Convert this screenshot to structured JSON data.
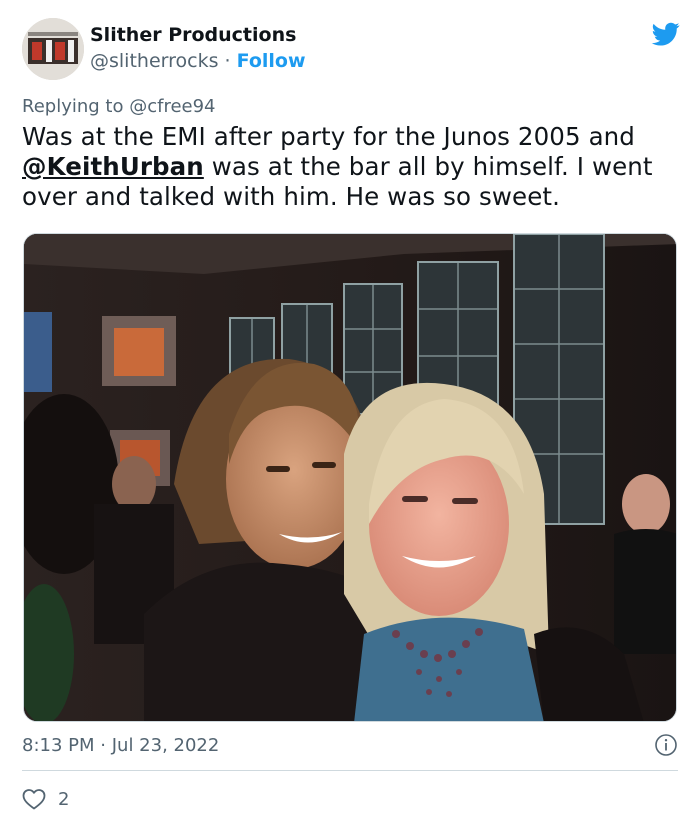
{
  "tweet": {
    "author_name": "Slither Productions",
    "author_handle": "@slitherrocks",
    "separator": "·",
    "follow_label": "Follow",
    "replying_prefix": "Replying to",
    "replying_to": "@cfree94",
    "text_before": "Was at the EMI after party for the Junos 2005 and",
    "mention": "@KeithUrban",
    "text_after": "was at the bar all by himself. I went over and talked with him. He was so sweet.",
    "time": "8:13 PM",
    "date": "Jul 23, 2022",
    "like_count": "2"
  },
  "icons": {
    "logo": "twitter-bird-icon",
    "info": "info-icon",
    "like": "heart-icon"
  },
  "colors": {
    "accent": "#1d9bf0",
    "text": "#0f1419",
    "muted": "#536471",
    "border": "#cfd9de"
  }
}
